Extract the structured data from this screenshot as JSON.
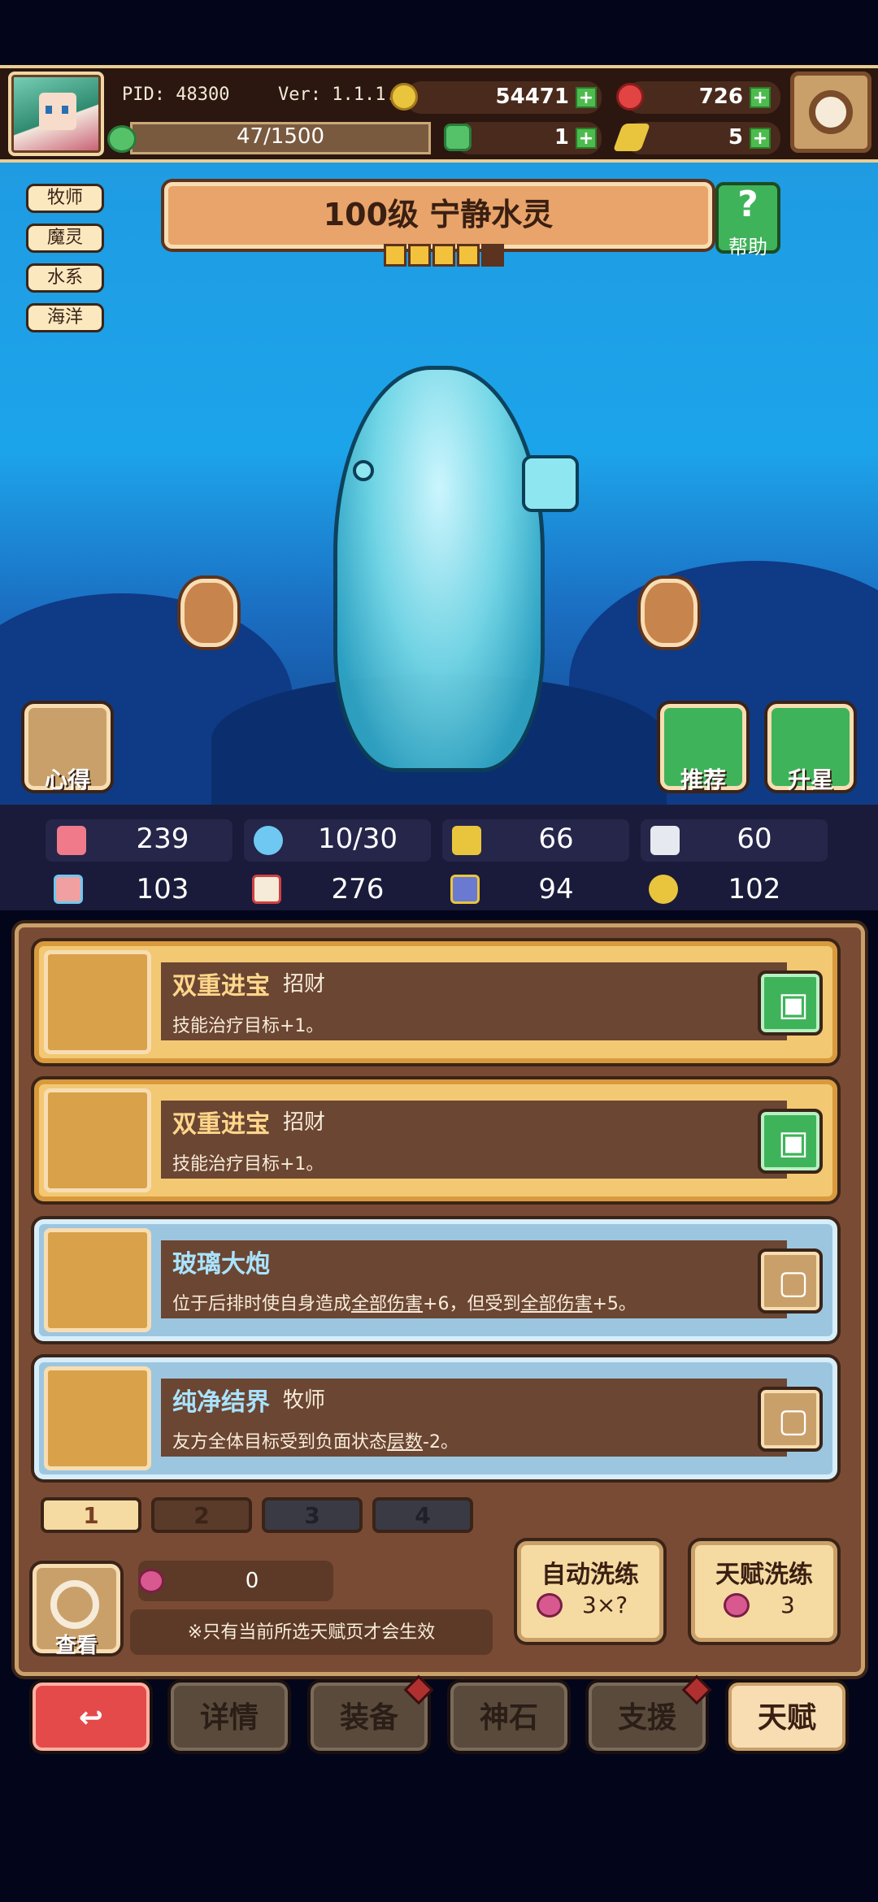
{
  "player": {
    "pid": "PID: 48300",
    "version": "Ver: 1.1.1.6",
    "xp": "47/1500"
  },
  "currencies": {
    "gold": "54471",
    "gems": "726",
    "clover": "1",
    "feather": "5"
  },
  "tags": [
    "牧师",
    "魔灵",
    "水系",
    "海洋"
  ],
  "hero": {
    "title": "100级  宁静水灵",
    "stars_filled": 4,
    "stars_total": 5
  },
  "help_label": "帮助",
  "scene_buttons": {
    "notes": "心得",
    "recommend": "推荐",
    "upgrade_star": "升星"
  },
  "stats": {
    "hp": "239",
    "mana": "10/30",
    "shield": "66",
    "speed": "60",
    "attack": "103",
    "book": "276",
    "defense": "94",
    "crit": "102"
  },
  "talents": [
    {
      "title": "双重进宝",
      "tag": "招财",
      "desc": "技能治疗目标+1。",
      "style": "gold",
      "locked_icon": "lock"
    },
    {
      "title": "双重进宝",
      "tag": "招财",
      "desc": "技能治疗目标+1。",
      "style": "gold",
      "locked_icon": "lock"
    },
    {
      "title": "玻璃大炮",
      "tag": "",
      "desc_a": "位于后排时使自身造成",
      "desc_u1": "全部伤害",
      "desc_b": "+6，但受到",
      "desc_u2": "全部伤害",
      "desc_c": "+5。",
      "style": "blue",
      "locked_icon": "unlock"
    },
    {
      "title": "纯净结界",
      "tag": "牧师",
      "desc_a": "友方全体目标受到负面状态",
      "desc_u1": "层数",
      "desc_b": "-2。",
      "style": "blue",
      "locked_icon": "unlock"
    }
  ],
  "pages": [
    "1",
    "2",
    "3",
    "4"
  ],
  "bottom": {
    "view_label": "查看",
    "peach_count": "0",
    "note": "※只有当前所选天赋页才会生效",
    "auto_wash": {
      "title": "自动洗练",
      "cost": "3×?"
    },
    "talent_wash": {
      "title": "天赋洗练",
      "cost": "3"
    }
  },
  "nav": {
    "back": "↩",
    "details": "详情",
    "equipment": "装备",
    "godstone": "神石",
    "support": "支援",
    "talent": "天赋"
  },
  "colors": {
    "accent": "#f8ddb2",
    "panel": "#7a4b34",
    "gold_card": "#f3c873",
    "blue_card": "#9cc6e0",
    "green_button": "#3fb35a",
    "back_button": "#e44a4a"
  }
}
